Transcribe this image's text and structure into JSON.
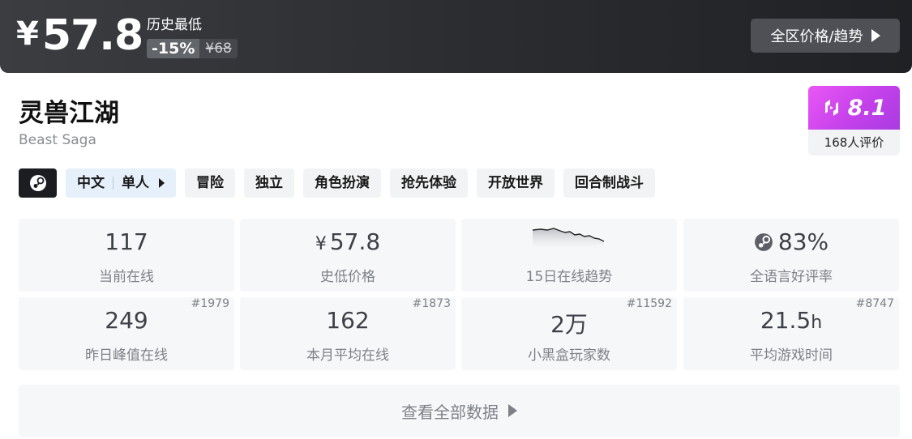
{
  "price": {
    "currency": "¥",
    "value": "57.8",
    "lowest_label": "历史最低",
    "discount": "-15%",
    "original": "¥68",
    "trend_button": "全区价格/趋势"
  },
  "game": {
    "title": "灵兽江湖",
    "subtitle": "Beast Saga"
  },
  "score": {
    "value": "8.1",
    "count": "168人评价"
  },
  "tags": {
    "lang": "中文",
    "mode": "单人",
    "items": [
      "冒险",
      "独立",
      "角色扮演",
      "抢先体验",
      "开放世界",
      "回合制战斗"
    ]
  },
  "stats": [
    {
      "value": "117",
      "label": "当前在线"
    },
    {
      "currency": "¥",
      "value": "57.8",
      "label": "史低价格"
    },
    {
      "label": "15日在线趋势"
    },
    {
      "value": "83%",
      "label": "全语言好评率"
    },
    {
      "value": "249",
      "label": "昨日峰值在线",
      "rank": "#1979"
    },
    {
      "value": "162",
      "label": "本月平均在线",
      "rank": "#1873"
    },
    {
      "value": "2万",
      "label": "小黑盒玩家数",
      "rank": "#11592"
    },
    {
      "value": "21.5",
      "unit": "h",
      "label": "平均游戏时间",
      "rank": "#8747"
    }
  ],
  "more_button": "查看全部数据",
  "colors": {
    "header_bg": "#2b2d31",
    "score_accent": "#d04cf0",
    "lang_tag_bg": "#e6f0fb",
    "card_bg": "#f6f7f8"
  },
  "icons": [
    "steam-icon",
    "heybox-score-icon",
    "chevron-right-icon"
  ]
}
